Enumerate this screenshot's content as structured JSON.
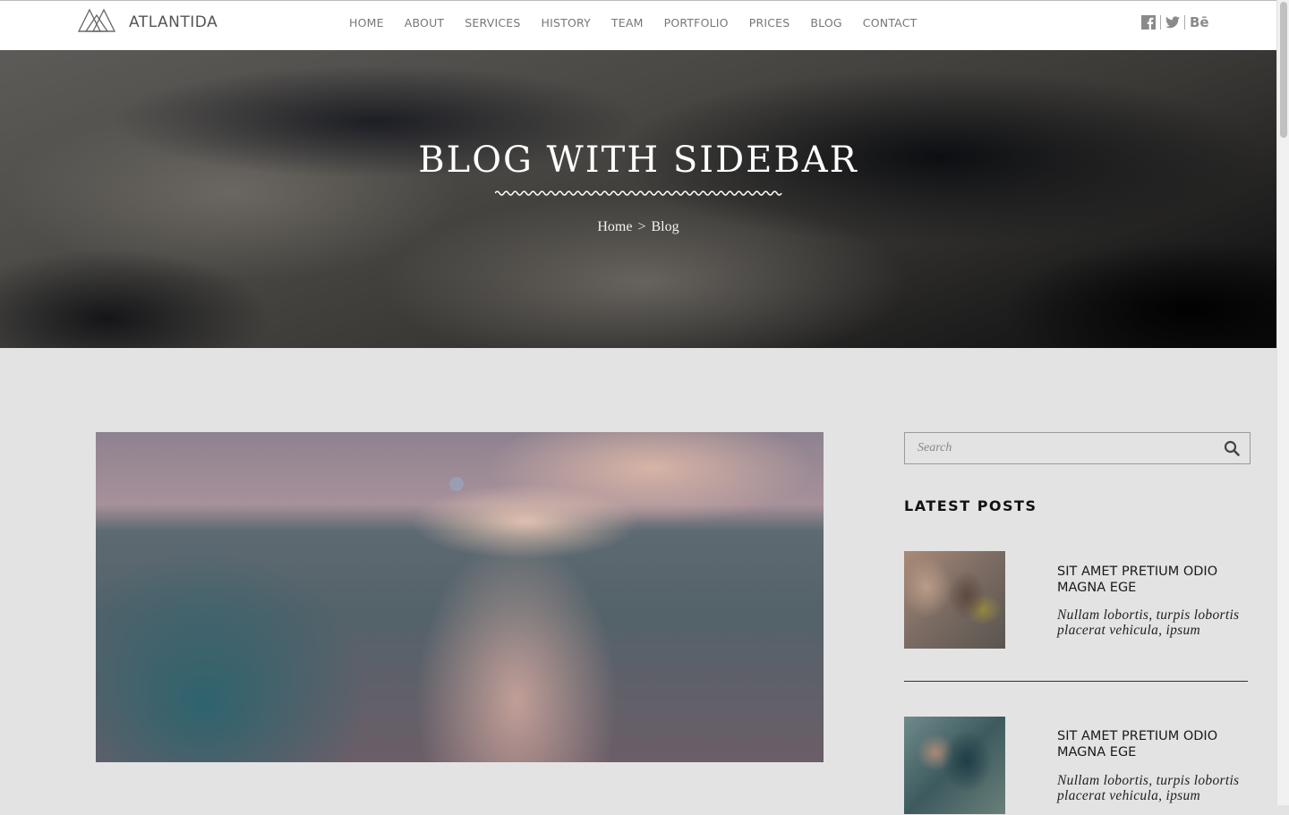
{
  "header": {
    "brand": "ATLANTIDA",
    "nav": [
      "HOME",
      "ABOUT",
      "SERVICES",
      "HISTORY",
      "TEAM",
      "PORTFOLIO",
      "PRICES",
      "BLOG",
      "CONTACT"
    ],
    "social": {
      "facebook_icon": "facebook-icon",
      "twitter_icon": "twitter-icon",
      "behance_label": "Bē"
    }
  },
  "hero": {
    "title": "BLOG WITH SIDEBAR",
    "breadcrumb": {
      "home": "Home",
      "separator": ">",
      "current": "Blog"
    }
  },
  "sidebar": {
    "search": {
      "placeholder": "Search",
      "icon": "search-icon"
    },
    "latest_posts_title": "LATEST POSTS",
    "latest_posts": [
      {
        "title": "SIT AMET PRETIUM ODIO MAGNA EGE",
        "excerpt": "Nullam lobortis, turpis lobortis placerat vehicula, ipsum"
      },
      {
        "title": "SIT AMET PRETIUM ODIO MAGNA EGE",
        "excerpt": "Nullam lobortis, turpis lobortis placerat vehicula, ipsum"
      }
    ]
  },
  "colors": {
    "page_background": "#e3e3e3",
    "header_background": "#ffffff",
    "nav_text": "#777777",
    "hero_title": "#ffffff"
  }
}
